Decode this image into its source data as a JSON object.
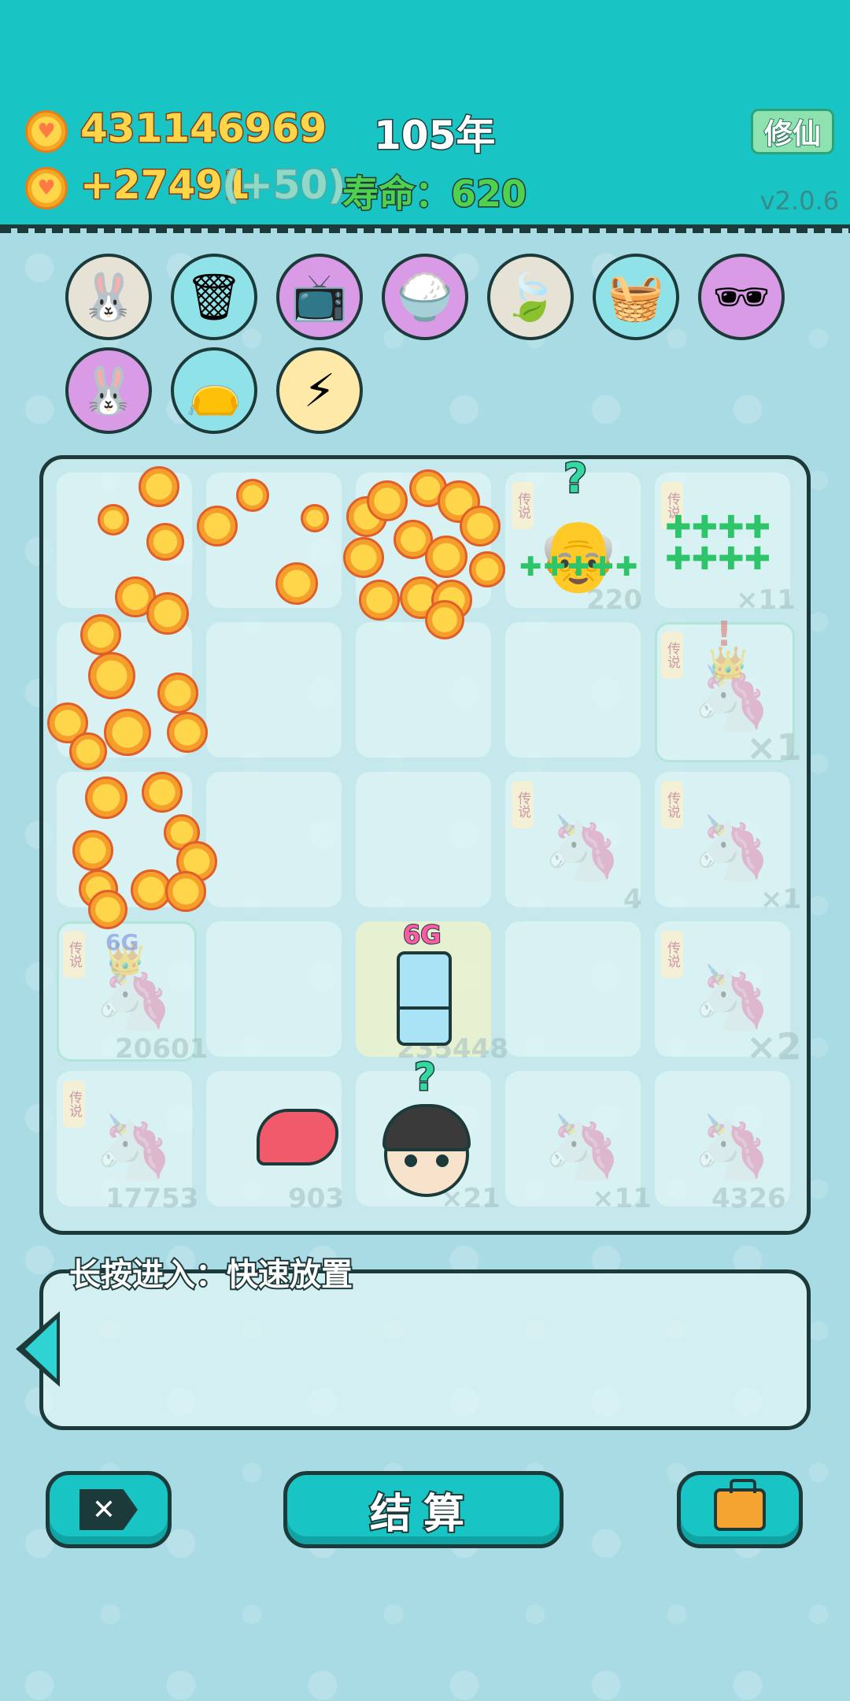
{
  "header": {
    "coins": "431146969",
    "income": "+27491",
    "income_bonus": "(+50)",
    "year": "105年",
    "lifespan_label": "寿命：",
    "lifespan_value": "620",
    "xiuxian_button": "修仙",
    "version": "v2.0.6"
  },
  "items": [
    {
      "icon": "rabbit-icon"
    },
    {
      "icon": "trash-bag-icon"
    },
    {
      "icon": "tv-icon"
    },
    {
      "icon": "rice-bowl-icon"
    },
    {
      "icon": "leaf-icon"
    },
    {
      "icon": "fruit-basket-icon"
    },
    {
      "icon": "glasses-icon"
    },
    {
      "icon": "rabbit-icon"
    },
    {
      "icon": "sack-icon"
    },
    {
      "icon": "lightning-icon"
    }
  ],
  "board": {
    "tags": [
      "传说",
      "传说",
      "传说",
      "传说",
      "传说",
      "传说",
      "传说",
      "传说"
    ],
    "faint_numbers": [
      "220",
      "×11",
      "×1",
      "4",
      "×1",
      "20601",
      "235448",
      "×2",
      "17753",
      "903",
      "×21",
      "×11",
      "4326"
    ],
    "fridge_label": "6G",
    "ghost_label": "6G",
    "question_marks": [
      "?",
      "?",
      "!"
    ]
  },
  "panel": {
    "hint": "长按进入：快速放置"
  },
  "buttons": {
    "settle": "结算"
  },
  "colors": {
    "accent": "#18c4c4",
    "outline": "#1d3a3a",
    "coin": "#ffd54a"
  }
}
